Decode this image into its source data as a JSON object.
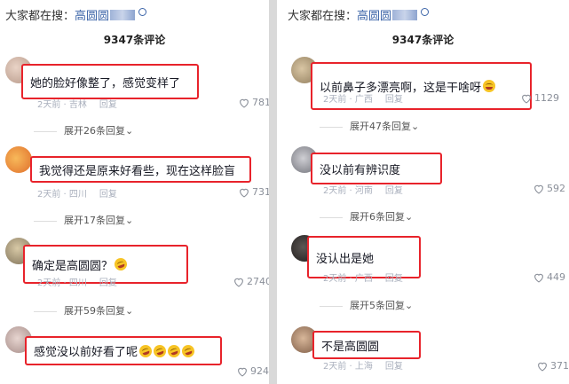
{
  "left": {
    "search_prefix": "大家都在搜：",
    "search_keyword": "高圆圆",
    "comment_count": "9347条评论",
    "comments": [
      {
        "text": "她的脸好像整了，感觉变样了",
        "meta": "2天前 · 吉林",
        "reply": "回复",
        "likes": "781",
        "expand": "展开26条回复"
      },
      {
        "text": "我觉得还是原来好看些，现在这样脸盲",
        "meta": "2天前 · 四川",
        "reply": "回复",
        "likes": "731",
        "expand": "展开17条回复"
      },
      {
        "text": "确定是高圆圆？",
        "meta": "2天前 · 四川",
        "reply": "回复",
        "likes": "2740",
        "expand": "展开59条回复"
      },
      {
        "text": "感觉没以前好看了呢",
        "meta": "",
        "reply": "",
        "likes": "924"
      }
    ]
  },
  "right": {
    "search_prefix": "大家都在搜：",
    "search_keyword": "高圆圆",
    "comment_count": "9347条评论",
    "comments": [
      {
        "text": "以前鼻子多漂亮啊，这是干啥呀",
        "meta": "2天前 · 广西",
        "reply": "回复",
        "likes": "1129",
        "expand": "展开47条回复"
      },
      {
        "text": "没以前有辨识度",
        "meta": "2天前 · 河南",
        "reply": "回复",
        "likes": "592",
        "expand": "展开6条回复"
      },
      {
        "text": "没认出是她",
        "meta": "2天前 · 广西",
        "reply": "回复",
        "likes": "449",
        "expand": "展开5条回复"
      },
      {
        "text": "不是高圆圆",
        "meta": "2天前 · 上海",
        "reply": "回复",
        "likes": "371"
      }
    ]
  },
  "icons": {
    "search": "search-icon",
    "like": "heart-icon",
    "expand": "chevron-down-icon",
    "emoji": "laughing-emoji-icon"
  },
  "colors": {
    "highlight_border": "#e8232b",
    "keyword": "#3b64a8",
    "meta": "#aab0bd"
  }
}
